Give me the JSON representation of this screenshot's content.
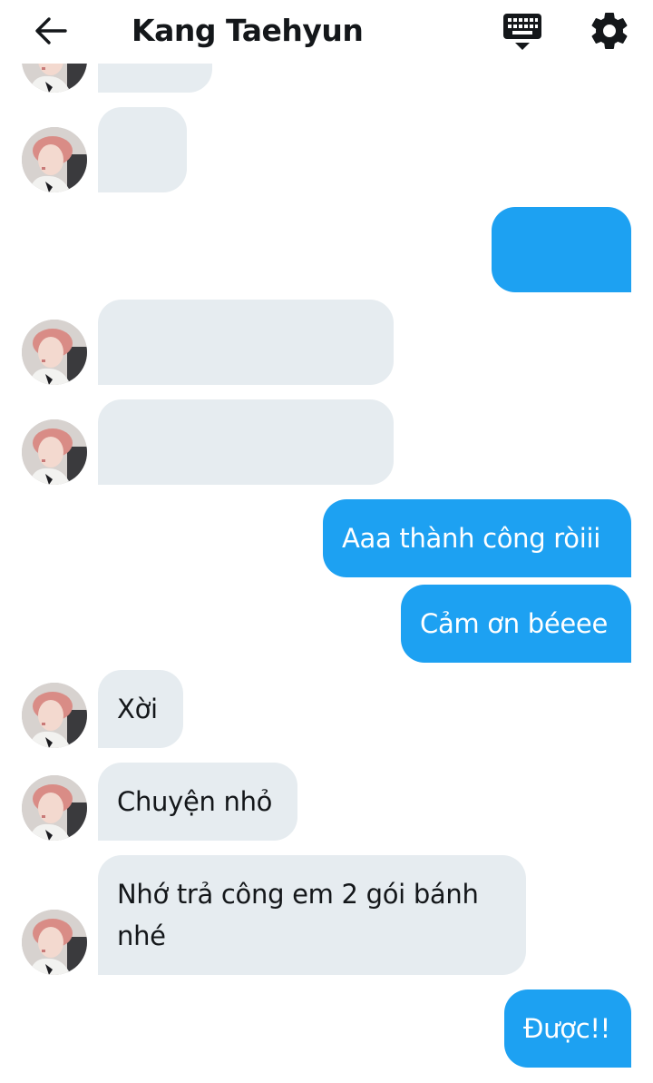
{
  "header": {
    "back_icon": "arrow-left-icon",
    "title": "Kang Taehyun",
    "keyboard_icon": "keyboard-icon",
    "settings_icon": "gear-icon"
  },
  "colors": {
    "incoming_bubble": "#e6ecf0",
    "outgoing_bubble": "#1da1f2",
    "title_text": "#14171a"
  },
  "messages": [
    {
      "sender": "them",
      "text": ""
    },
    {
      "sender": "them",
      "text": ""
    },
    {
      "sender": "me",
      "text": ""
    },
    {
      "sender": "them",
      "text": ""
    },
    {
      "sender": "them",
      "text": ""
    },
    {
      "sender": "me",
      "text": "Aaa thành công ròiii"
    },
    {
      "sender": "me",
      "text": "Cảm ơn béeee"
    },
    {
      "sender": "them",
      "text": "Xời"
    },
    {
      "sender": "them",
      "text": "Chuyện nhỏ"
    },
    {
      "sender": "them",
      "text": "Nhớ trả công em 2 gói bánh nhé"
    },
    {
      "sender": "me",
      "text": "Được!!"
    }
  ]
}
